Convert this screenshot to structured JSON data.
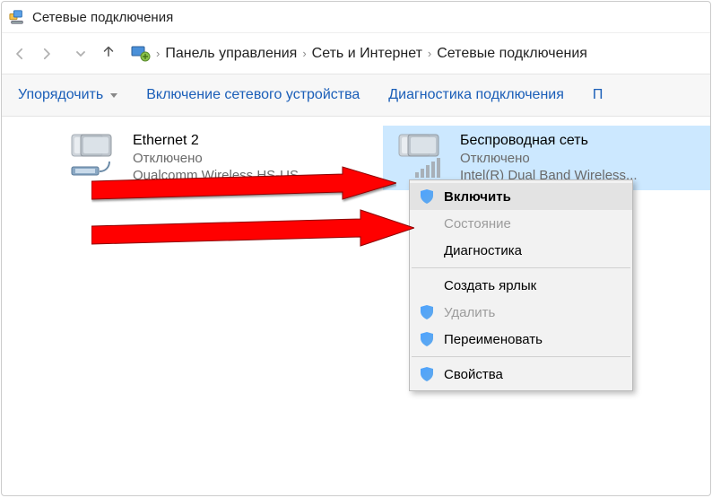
{
  "window": {
    "title": "Сетевые подключения"
  },
  "breadcrumb": {
    "items": [
      "Панель управления",
      "Сеть и Интернет",
      "Сетевые подключения"
    ]
  },
  "toolbar": {
    "organize": "Упорядочить",
    "enable_device": "Включение сетевого устройства",
    "diagnostics": "Диагностика подключения",
    "more": "П"
  },
  "connections": [
    {
      "title": "Ethernet 2",
      "status": "Отключено",
      "device": "Qualcomm Wireless HS-US..."
    },
    {
      "title": "Беспроводная сеть",
      "status": "Отключено",
      "device": "Intel(R) Dual Band Wireless..."
    }
  ],
  "context_menu": {
    "enable": "Включить",
    "state": "Состояние",
    "diagnostics": "Диагностика",
    "create_shortcut": "Создать ярлык",
    "delete": "Удалить",
    "rename": "Переименовать",
    "properties": "Свойства"
  }
}
